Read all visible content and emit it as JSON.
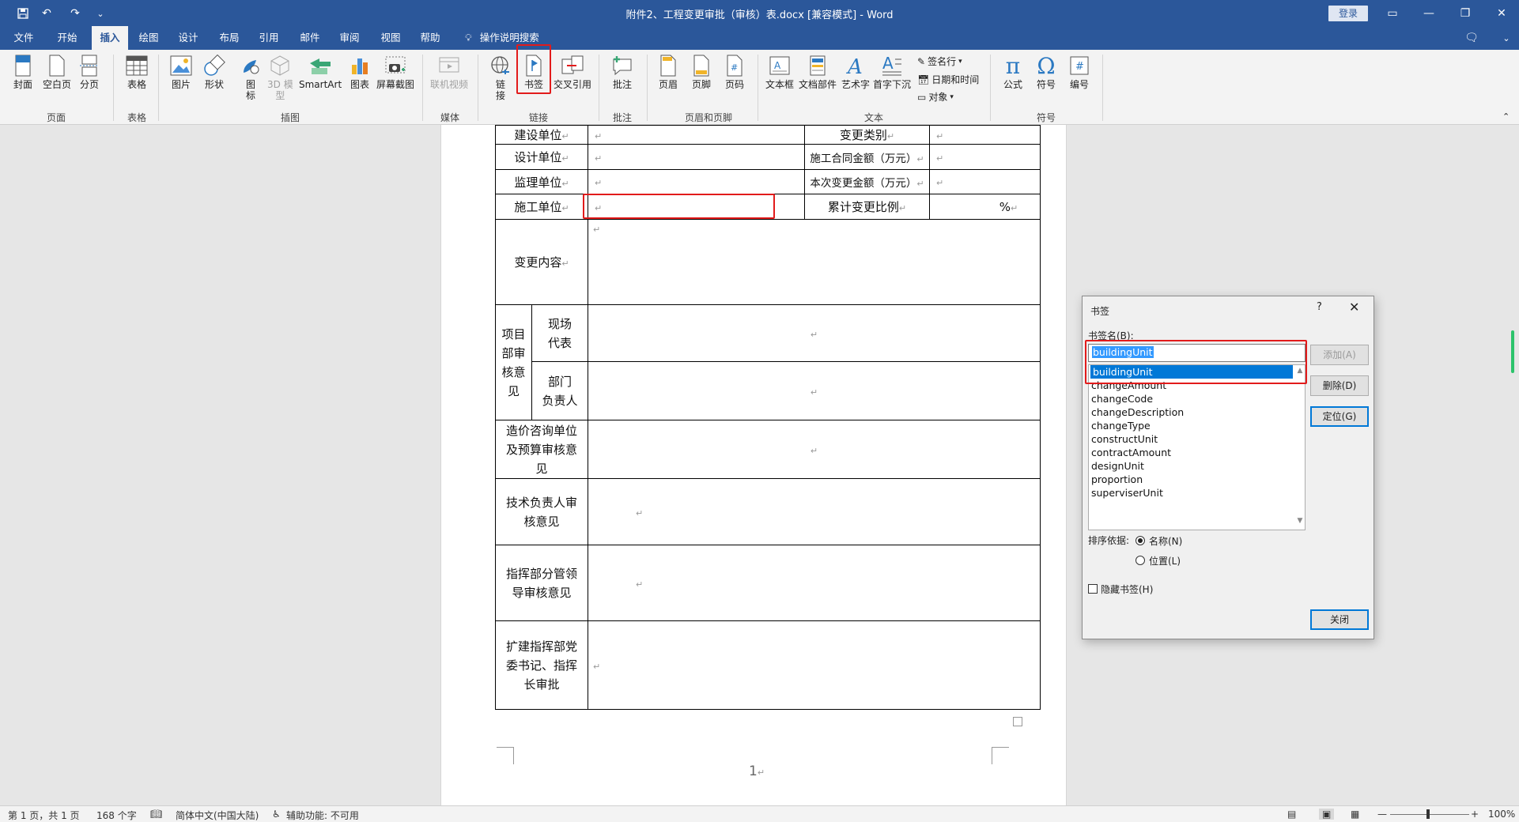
{
  "window": {
    "title": "附件2、工程变更审批（审核）表.docx [兼容模式] - Word",
    "login": "登录"
  },
  "tabs": [
    "文件",
    "开始",
    "插入",
    "绘图",
    "设计",
    "布局",
    "引用",
    "邮件",
    "审阅",
    "视图",
    "帮助"
  ],
  "active_tab": "插入",
  "search": "操作说明搜索",
  "ribbon": {
    "pages": {
      "cover": "封面",
      "blank": "空白页",
      "break": "分页",
      "group": "页面"
    },
    "tables": {
      "table": "表格",
      "group": "表格"
    },
    "illustrations": {
      "picture": "图片",
      "shapes": "形状",
      "icons": "图\n标",
      "model3d": "3D 模\n型",
      "smartart": "SmartArt",
      "chart": "图表",
      "screenshot": "屏幕截图",
      "group": "插图"
    },
    "media": {
      "video": "联机视频",
      "group": "媒体"
    },
    "links": {
      "link": "链\n接",
      "bookmark": "书签",
      "crossref": "交叉引用",
      "group": "链接"
    },
    "comments": {
      "comment": "批注",
      "group": "批注"
    },
    "headerfooter": {
      "header": "页眉",
      "footer": "页脚",
      "pagenum": "页码",
      "group": "页眉和页脚"
    },
    "text": {
      "textbox": "文本框",
      "quickparts": "文档部件",
      "wordart": "艺术字",
      "dropcap": "首字下沉",
      "sigline": "签名行",
      "datetime": "日期和时间",
      "object": "对象",
      "group": "文本"
    },
    "symbols": {
      "equation": "公式",
      "symbol": "符号",
      "number": "编号",
      "group": "符号"
    }
  },
  "form": {
    "r1": {
      "a": "建设单位",
      "c": "变更类别"
    },
    "r2": {
      "a": "设计单位",
      "c": "施工合同金额（万元）"
    },
    "r3": {
      "a": "监理单位",
      "c": "本次变更金额（万元）"
    },
    "r4": {
      "a": "施工单位",
      "c": "累计变更比例",
      "d": "%"
    },
    "r5": {
      "a": "变更内容"
    },
    "r6": {
      "a": "项目\n部审\n核意\n见",
      "b1": "现场\n代表",
      "b2": "部门\n负责人"
    },
    "r7": {
      "a": "造价咨询单位\n及预算审核意\n见"
    },
    "r8": {
      "a": "技术负责人审\n核意见"
    },
    "r9": {
      "a": "指挥部分管领\n导审核意见"
    },
    "r10": {
      "a": "扩建指挥部党\n委书记、指挥\n长审批"
    },
    "mark": "↵",
    "page_number": "1"
  },
  "dialog": {
    "title": "书签",
    "help": "?",
    "name_label": "书签名(B):",
    "name_value": "buildingUnit",
    "items": [
      "buildingUnit",
      "changeAmount",
      "changeCode",
      "changeDescription",
      "changeType",
      "constructUnit",
      "contractAmount",
      "designUnit",
      "proportion",
      "superviserUnit"
    ],
    "selected": "buildingUnit",
    "add": "添加(A)",
    "delete": "删除(D)",
    "goto": "定位(G)",
    "sort_label": "排序依据:",
    "sort_name": "名称(N)",
    "sort_location": "位置(L)",
    "sort_selected": "名称(N)",
    "hidden": "隐藏书签(H)",
    "close": "关闭"
  },
  "status": {
    "page": "第 1 页，共 1 页",
    "words": "168 个字",
    "lang": "简体中文(中国大陆)",
    "accessibility": "辅助功能: 不可用",
    "zoom": "100%"
  },
  "colors": {
    "accent": "#2b579a",
    "highlight": "#e21b1b",
    "selection": "#0078d7"
  }
}
